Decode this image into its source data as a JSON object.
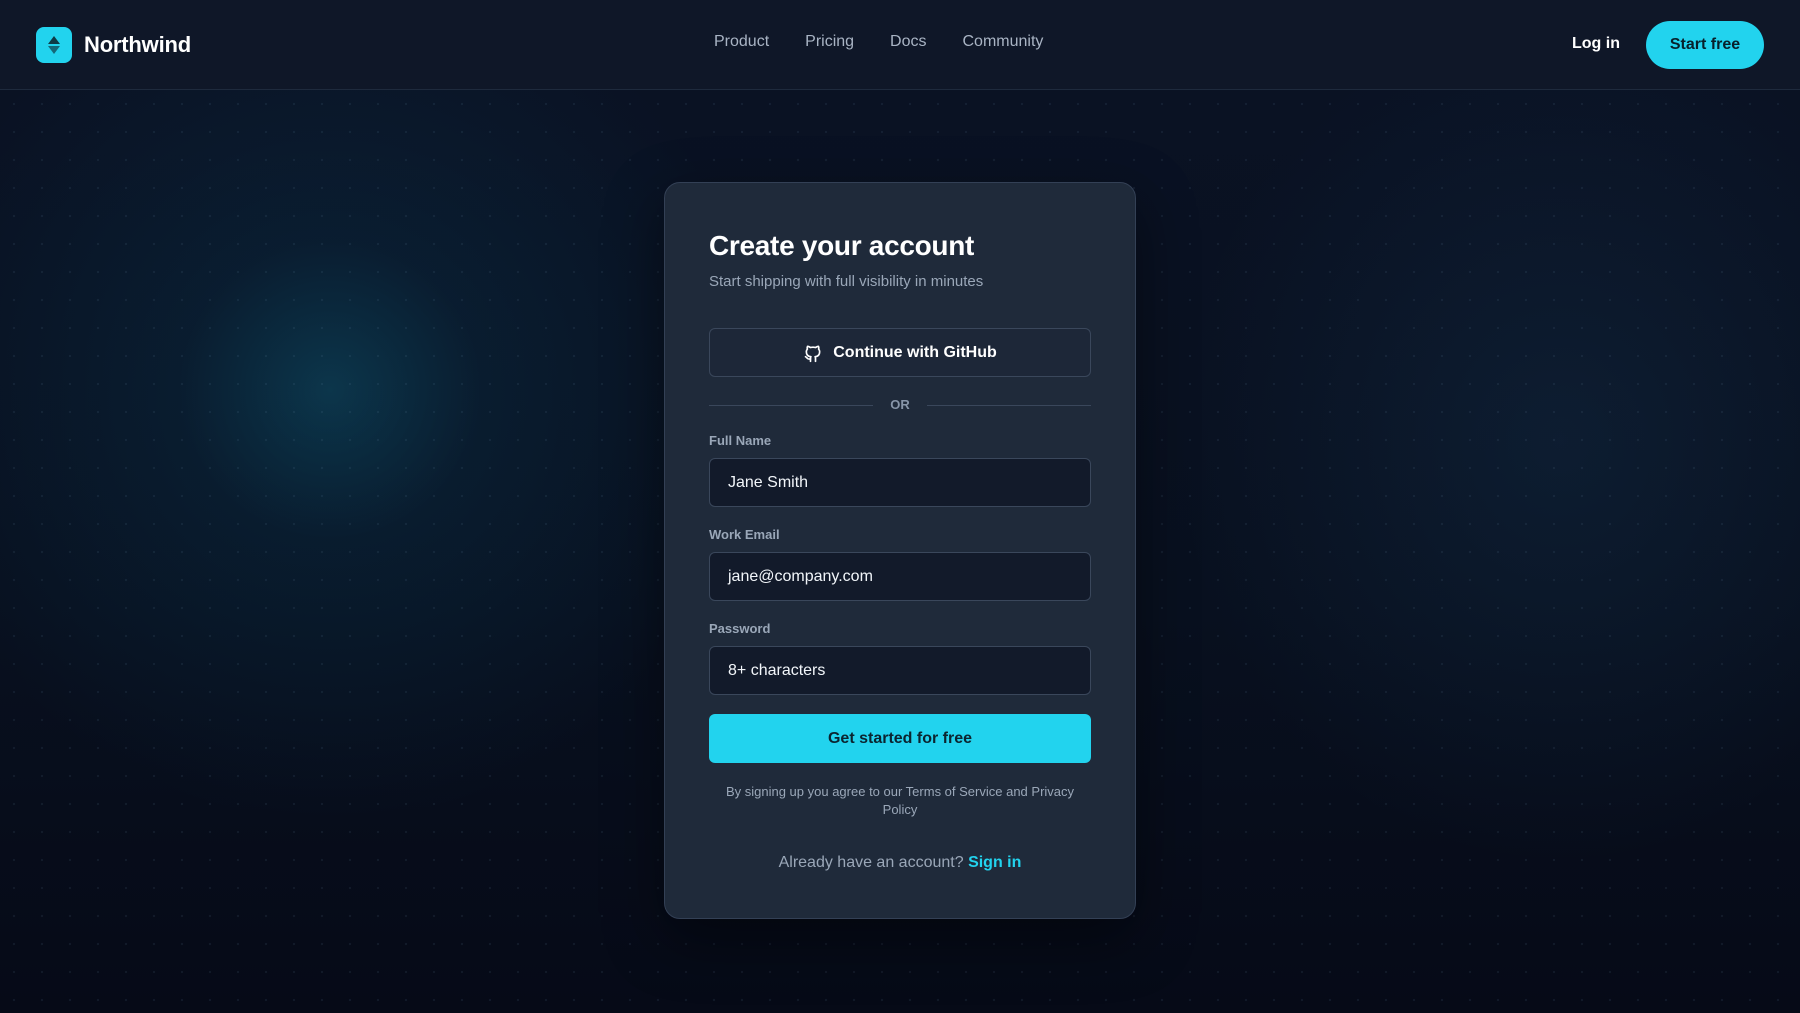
{
  "nav": {
    "brand": "Northwind",
    "links": [
      "Product",
      "Pricing",
      "Docs",
      "Community"
    ],
    "login_label": "Log in",
    "start_label": "Start free"
  },
  "form": {
    "title": "Create your account",
    "subtitle": "Start shipping with full visibility in minutes",
    "github_label": "Continue with GitHub",
    "divider_text": "OR",
    "fields": [
      {
        "label": "Full Name",
        "value": "Jane Smith"
      },
      {
        "label": "Work Email",
        "value": "jane@company.com"
      },
      {
        "label": "Password",
        "placeholder": "8+ characters"
      }
    ],
    "submit_label": "Get started for free",
    "terms": "By signing up you agree to our Terms of Service and Privacy Policy",
    "signin_prompt": "Already have an account?",
    "signin_link": "Sign in"
  },
  "colors": {
    "accent": "#22d3ee",
    "background": "#070c1a",
    "card": "#1f2a3a"
  },
  "icons": {
    "brand_logo": "northwind-logo-icon",
    "github": "github-icon"
  }
}
